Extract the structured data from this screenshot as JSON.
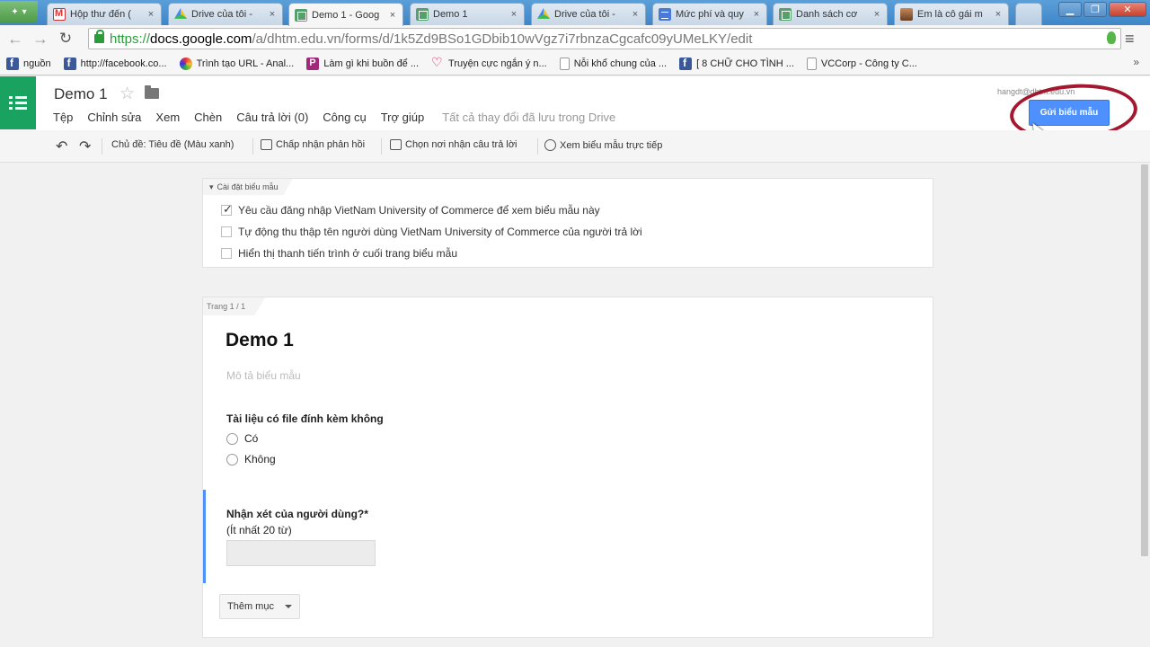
{
  "browser": {
    "tabs": [
      {
        "title": "Hộp thư đến (",
        "icon": "gmail-icon",
        "close": "×"
      },
      {
        "title": "Drive của tôi -",
        "icon": "drive-icon",
        "close": "×"
      },
      {
        "title": "Demo 1 - Goog",
        "icon": "forms-icon",
        "close": "×",
        "active": true
      },
      {
        "title": "Demo 1",
        "icon": "forms-icon",
        "close": "×"
      },
      {
        "title": "Drive của tôi -",
        "icon": "drive-icon",
        "close": "×"
      },
      {
        "title": "Mức phí và quy",
        "icon": "docs-icon",
        "close": "×"
      },
      {
        "title": "Danh sách cơ",
        "icon": "sheets-icon",
        "close": "×"
      },
      {
        "title": "Em là cô gái m",
        "icon": "photo-icon",
        "close": "×"
      }
    ],
    "address": {
      "scheme": "https://",
      "host": "docs.google.com",
      "path": "/a/dhtm.edu.vn/forms/d/1k5Zd9BSo1GDbib10wVgz7i7rbnzaCgcafc09yUMeLKY/edit"
    },
    "bookmarks": [
      {
        "label": "nguồn",
        "icon": "facebook-icon"
      },
      {
        "label": "http://facebook.co...",
        "icon": "facebook-icon"
      },
      {
        "label": "Trình tạo URL - Anal...",
        "icon": "link-icon"
      },
      {
        "label": "Làm gì khi buồn để ...",
        "icon": "p-icon"
      },
      {
        "label": "Truyện cực ngắn ý n...",
        "icon": "heart-icon"
      },
      {
        "label": "Nỗi khổ chung của ...",
        "icon": "page-icon"
      },
      {
        "label": "[ 8 CHỮ CHO TÌNH ...",
        "icon": "facebook-icon"
      },
      {
        "label": "VCCorp - Công ty C...",
        "icon": "page-icon"
      }
    ],
    "overflow": "»"
  },
  "header": {
    "doc_title": "Demo 1",
    "menus": [
      "Tệp",
      "Chỉnh sửa",
      "Xem",
      "Chèn",
      "Câu trả lời (0)",
      "Công cụ",
      "Trợ giúp"
    ],
    "saved_status": "Tất cả thay đổi đã lưu trong Drive",
    "user_email": "hangdt@dhtm.edu.vn",
    "send_button": "Gửi biểu mẫu"
  },
  "toolbar": {
    "theme": "Chủ đề: Tiêu đề (Màu xanh)",
    "accept": "Chấp nhận phản hồi",
    "destination": "Chọn nơi nhận câu trả lời",
    "view_live": "Xem biểu mẫu trực tiếp"
  },
  "settings": {
    "tab_label": "Cài đặt biểu mẫu",
    "options": [
      {
        "label": "Yêu cầu đăng nhập VietNam University of Commerce để xem biểu mẫu này",
        "checked": true
      },
      {
        "label": "Tự động thu thập tên người dùng VietNam University of Commerce của người trả lời",
        "checked": false
      },
      {
        "label": "Hiển thị thanh tiến trình ở cuối trang biểu mẫu",
        "checked": false
      }
    ]
  },
  "form": {
    "page_label": "Trang 1 / 1",
    "title": "Demo 1",
    "description_placeholder": "Mô tả biểu mẫu",
    "questions": [
      {
        "title": "Tài liệu có file đính kèm không",
        "options": [
          "Có",
          "Không"
        ]
      },
      {
        "title": "Nhận xét của người dùng?",
        "required_mark": "*",
        "help": "(Ít nhất 20 từ)"
      }
    ],
    "add_item": "Thêm mục"
  },
  "colors": {
    "forms_green": "#1aa260",
    "send_blue": "#4d90fe",
    "annotation_red": "#a3182f"
  }
}
